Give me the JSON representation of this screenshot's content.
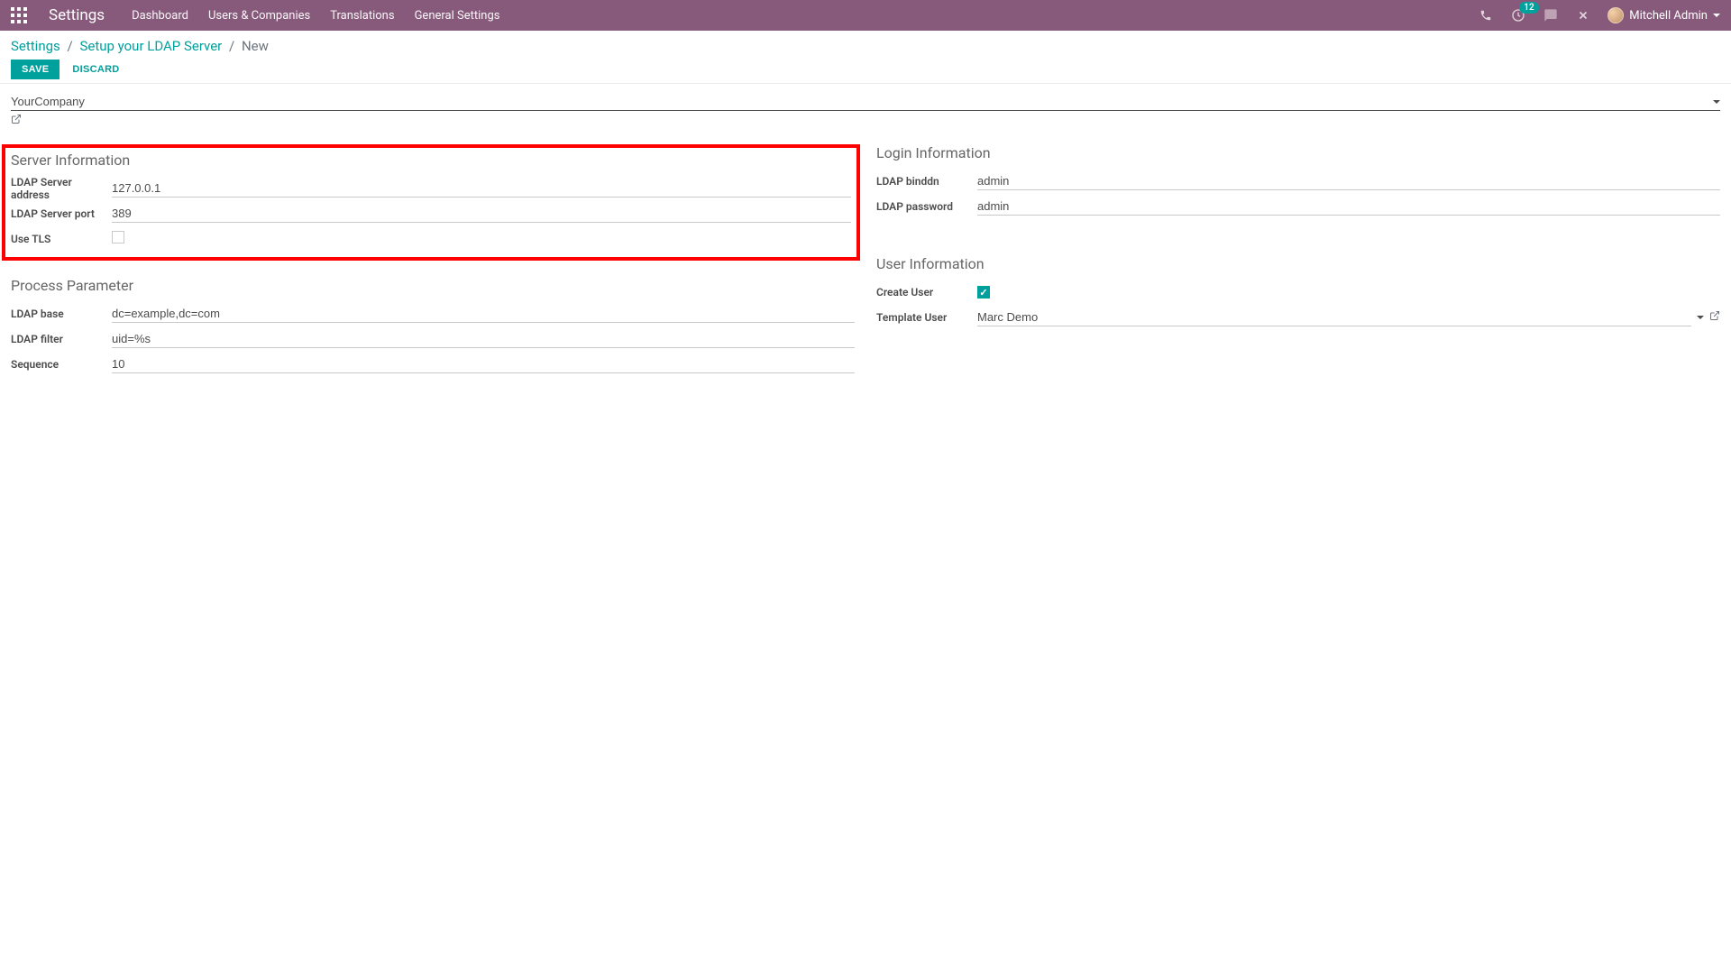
{
  "nav": {
    "app_title": "Settings",
    "menu": [
      "Dashboard",
      "Users & Companies",
      "Translations",
      "General Settings"
    ],
    "badge_count": "12",
    "user_name": "Mitchell Admin"
  },
  "breadcrumbs": {
    "root": "Settings",
    "parent": "Setup your LDAP Server",
    "current": "New"
  },
  "actions": {
    "save": "SAVE",
    "discard": "DISCARD"
  },
  "form": {
    "company": "YourCompany",
    "server_info": {
      "title": "Server Information",
      "address_label": "LDAP Server address",
      "address": "127.0.0.1",
      "port_label": "LDAP Server port",
      "port": "389",
      "tls_label": "Use TLS",
      "tls": false
    },
    "login_info": {
      "title": "Login Information",
      "binddn_label": "LDAP binddn",
      "binddn": "admin",
      "password_label": "LDAP password",
      "password": "admin"
    },
    "process": {
      "title": "Process Parameter",
      "base_label": "LDAP base",
      "base": "dc=example,dc=com",
      "filter_label": "LDAP filter",
      "filter": "uid=%s",
      "sequence_label": "Sequence",
      "sequence": "10"
    },
    "user_info": {
      "title": "User Information",
      "create_user_label": "Create User",
      "create_user": true,
      "template_label": "Template User",
      "template": "Marc Demo"
    }
  }
}
